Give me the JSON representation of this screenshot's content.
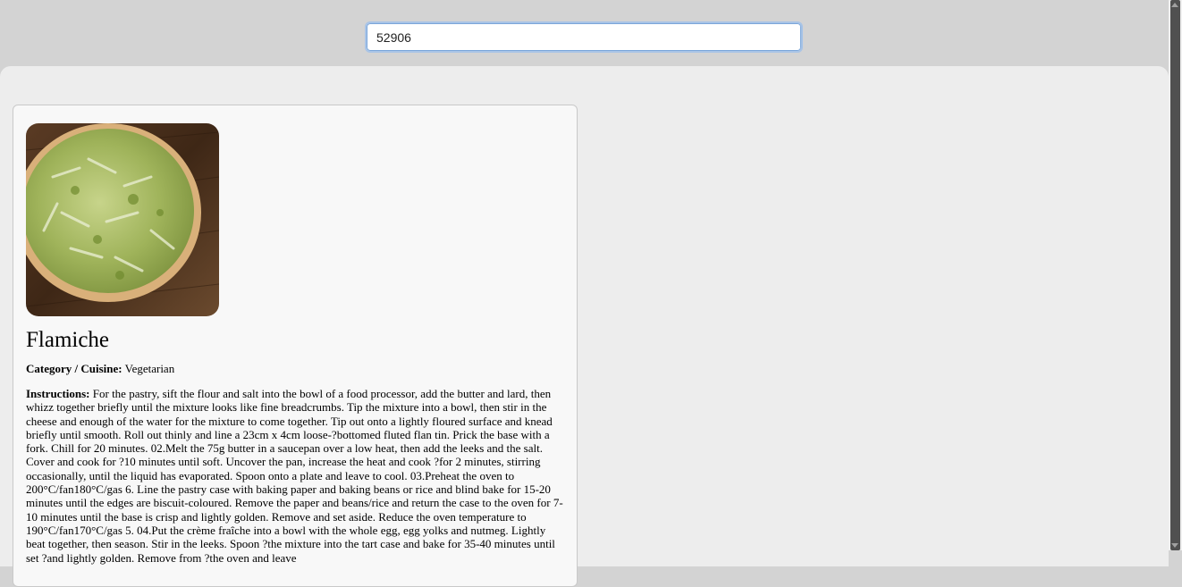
{
  "search": {
    "value": "52906"
  },
  "recipe": {
    "image_alt": "Flamiche",
    "title": "Flamiche",
    "category_label": "Category / Cuisine:",
    "category_value": "Vegetarian",
    "instructions_label": "Instructions:",
    "instructions_text": "For the pastry, sift the flour and salt into the bowl of a food processor, add the butter and lard, then whizz together briefly until the mixture looks like fine breadcrumbs. Tip the mixture into a bowl, then stir in the cheese and enough of the water for the mixture to come together. Tip out onto a lightly floured surface and knead briefly until smooth. Roll out thinly and line a 23cm x 4cm loose-?bottomed fluted flan tin. Prick the base with a fork. Chill for 20 minutes. 02.Melt the 75g butter in a saucepan over a low heat, then add the leeks and the salt. Cover and cook for ?10 minutes until soft. Uncover the pan, increase the heat and cook ?for 2 minutes, stirring occasionally, until the liquid has evaporated. Spoon onto a plate and leave to cool. 03.Preheat the oven to 200°C/fan180°C/gas 6. Line the pastry case with baking paper and baking beans or rice and blind bake for 15-20 minutes until the edges are biscuit-coloured. Remove the paper and beans/rice and return the case to the oven for 7-10 minutes until the base is crisp and lightly golden. Remove and set aside. Reduce the oven temperature to 190°C/fan170°C/gas 5. 04.Put the crème fraîche into a bowl with the whole egg, egg yolks and nutmeg. Lightly beat together, then season. Stir in the leeks. Spoon ?the mixture into the tart case and bake for 35-40 minutes until set ?and lightly golden. Remove from ?the oven and leave"
  }
}
